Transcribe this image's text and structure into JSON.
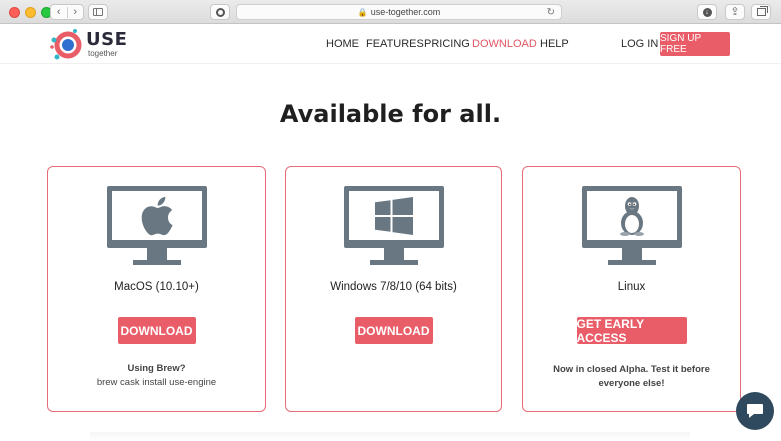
{
  "browser": {
    "url": "use-together.com",
    "back_glyph": "‹",
    "forward_glyph": "›",
    "reload_glyph": "↻",
    "share_glyph": "⇪"
  },
  "header": {
    "logo_text": "USE",
    "logo_sub": "together",
    "nav": [
      {
        "label": "HOME"
      },
      {
        "label": "FEATURES"
      },
      {
        "label": "PRICING"
      },
      {
        "label": "DOWNLOAD",
        "active": true
      },
      {
        "label": "HELP"
      }
    ],
    "login_label": "LOG IN",
    "signup_label": "SIGN UP FREE"
  },
  "main": {
    "title": "Available for all.",
    "cards": [
      {
        "os": "MacOS (10.10+)",
        "icon": "apple-icon",
        "button": "DOWNLOAD",
        "note_title": "Using Brew?",
        "note_cmd": "brew cask install use-engine"
      },
      {
        "os": "Windows 7/8/10 (64 bits)",
        "icon": "windows-icon",
        "button": "DOWNLOAD"
      },
      {
        "os": "Linux",
        "icon": "tux-icon",
        "button": "GET EARLY ACCESS",
        "note": "Now in closed Alpha. Test it before everyone else!"
      }
    ]
  },
  "colors": {
    "accent": "#e95d69",
    "card_border": "#e66c79",
    "monitor": "#687782",
    "chat": "#2f4a5e"
  }
}
